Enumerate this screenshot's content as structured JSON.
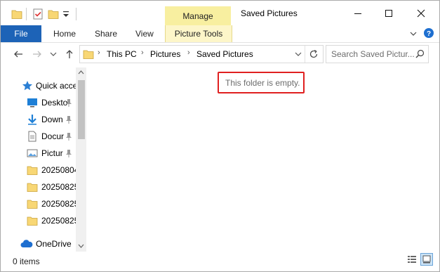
{
  "window": {
    "title": "Saved Pictures",
    "context_group": "Manage"
  },
  "ribbon": {
    "tabs": [
      "File",
      "Home",
      "Share",
      "View"
    ],
    "context_tab": "Picture Tools"
  },
  "address": {
    "crumbs": [
      "This PC",
      "Pictures",
      "Saved Pictures"
    ]
  },
  "search": {
    "placeholder": "Search Saved Pictur..."
  },
  "nav": {
    "quick_access": "Quick acce",
    "items": [
      {
        "label": "Deskto",
        "icon": "desktop-icon",
        "pinned": true
      },
      {
        "label": "Down",
        "icon": "downloads-icon",
        "pinned": true
      },
      {
        "label": "Docur",
        "icon": "documents-icon",
        "pinned": true
      },
      {
        "label": "Pictur",
        "icon": "pictures-icon",
        "pinned": true
      },
      {
        "label": "20250804",
        "icon": "folder-icon",
        "pinned": false
      },
      {
        "label": "20250825",
        "icon": "folder-icon",
        "pinned": false
      },
      {
        "label": "20250825",
        "icon": "folder-icon",
        "pinned": false
      },
      {
        "label": "20250825",
        "icon": "folder-icon",
        "pinned": false
      }
    ],
    "onedrive": "OneDrive"
  },
  "content": {
    "empty_message": "This folder is empty."
  },
  "status": {
    "item_count": "0 items"
  },
  "colors": {
    "file_tab": "#1d63b7",
    "context_tab": "#f8efa0",
    "highlight_box": "#e02020",
    "folder": "#f8d775"
  }
}
